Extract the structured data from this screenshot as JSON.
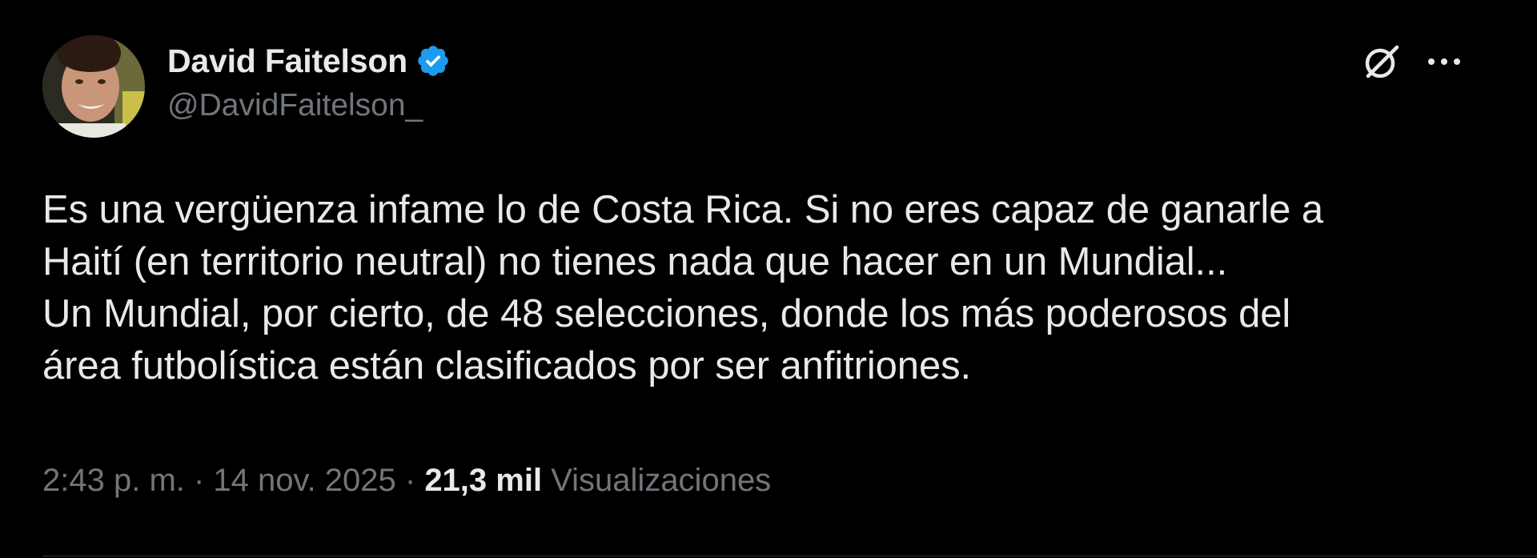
{
  "tweet": {
    "author": {
      "display_name": "David Faitelson",
      "handle": "@DavidFaitelson_",
      "verified_icon": "verified-badge-icon",
      "avatar_icon": "avatar"
    },
    "text": "Es una vergüenza infame lo de Costa Rica. Si no eres capaz de ganarle a\nHaití (en territorio neutral) no tienes nada que hacer en un Mundial...\nUn Mundial, por cierto,  de 48 selecciones, donde los más poderosos del\nárea futbolística están clasificados por ser anfitriones.",
    "time": "2:43 p. m.",
    "separator": " · ",
    "date": "14 nov. 2025",
    "views_count": "21,3 mil",
    "views_label": "Visualizaciones",
    "actions": {
      "grok_icon": "grok-icon",
      "more_icon": "more-options-icon"
    }
  },
  "colors": {
    "background": "#000000",
    "primary_text": "#e7e9ea",
    "secondary_text": "#71767b",
    "verified_blue": "#1d9bf0"
  }
}
